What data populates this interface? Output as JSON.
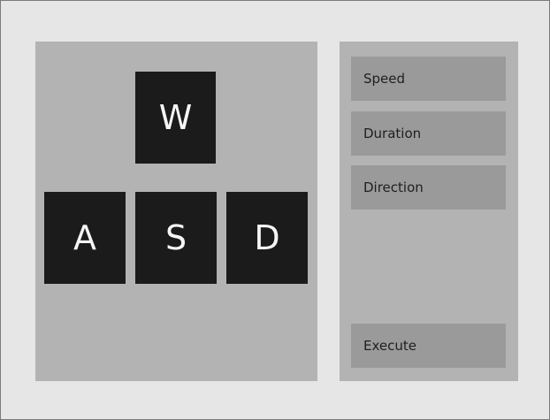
{
  "keypad": {
    "keys": {
      "w": "W",
      "a": "A",
      "s": "S",
      "d": "D"
    }
  },
  "controls": {
    "fields": {
      "speed": "Speed",
      "duration": "Duration",
      "direction": "Direction"
    },
    "execute_label": "Execute"
  },
  "colors": {
    "background": "#e6e6e6",
    "panel": "#b3b3b3",
    "key": "#1b1b1b",
    "field": "#9a9a9a",
    "key_text": "#f5f5f5",
    "field_text": "#1f1f1f"
  }
}
